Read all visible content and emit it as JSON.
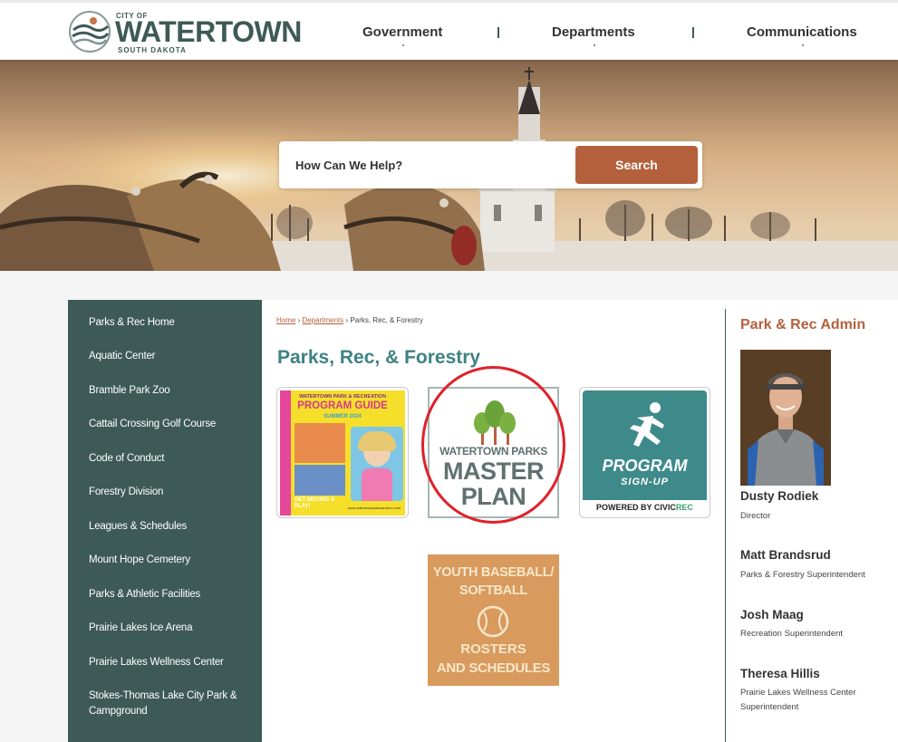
{
  "logo": {
    "city_of": "CITY OF",
    "name": "WATERTOWN",
    "state": "SOUTH DAKOTA"
  },
  "nav": [
    "Government",
    "Departments",
    "Communications"
  ],
  "search": {
    "placeholder": "How Can We Help?",
    "button": "Search"
  },
  "sidebar": {
    "items": [
      "Parks & Rec Home",
      "Aquatic Center",
      "Bramble Park Zoo",
      "Cattail Crossing Golf Course",
      "Code of Conduct",
      "Forestry Division",
      "Leagues & Schedules",
      "Mount Hope Cemetery",
      "Parks & Athletic Facilities",
      "Prairie Lakes Ice Arena",
      "Prairie Lakes Wellness Center",
      "Stokes-Thomas Lake City Park & Campground"
    ]
  },
  "breadcrumb": {
    "home": "Home",
    "sep": "›",
    "departments": "Departments",
    "current": "Parks, Rec, & Forestry"
  },
  "page_title": "Parks, Rec, & Forestry",
  "tiles": {
    "program_guide": {
      "top": "WATERTOWN PARK & RECREATION",
      "title": "PROGRAM GUIDE",
      "season": "SUMMER 2024",
      "tag": "GET MOVING & PLAY!",
      "url": "www.watertownparksandrec.com"
    },
    "master_plan": {
      "line1": "WATERTOWN PARKS",
      "line2": "MASTER",
      "line3": "PLAN"
    },
    "signup": {
      "line1": "PROGRAM",
      "line2": "SIGN-UP",
      "powered": "POWERED BY",
      "brand": "CIVIC",
      "brand2": "REC"
    },
    "baseball": {
      "line1": "YOUTH BASEBALL/",
      "line2": "SOFTBALL",
      "line3": "ROSTERS",
      "line4": "AND SCHEDULES"
    }
  },
  "admin": {
    "title": "Park & Rec Admin",
    "people": [
      {
        "name": "Dusty Rodiek",
        "role": "Director"
      },
      {
        "name": "Matt Brandsrud",
        "role": "Parks & Forestry Superintendent"
      },
      {
        "name": "Josh Maag",
        "role": "Recreation Superintendent"
      },
      {
        "name": "Theresa Hillis",
        "role": "Prairie Lakes Wellness Center Superintendent"
      }
    ]
  },
  "colors": {
    "brand_teal": "#3e5a57",
    "accent_rust": "#b5603d",
    "title_teal": "#3e8283",
    "annotation_red": "#e0202a"
  }
}
